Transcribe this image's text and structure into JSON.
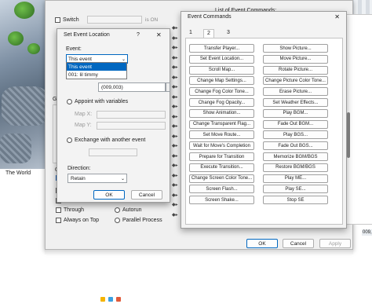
{
  "map": {
    "label": "The World"
  },
  "bottom_code": "009,",
  "editor": {
    "switch_label": "Switch",
    "switch_on": "is ON",
    "list_label": "List of Event Commands:",
    "options": [
      "Through",
      "Always on Top"
    ],
    "triggers": [
      "Autorun",
      "Parallel Process"
    ],
    "section_labels": {
      "graphic": "Grap",
      "options": "Op"
    },
    "buttons": {
      "ok": "OK",
      "cancel": "Cancel",
      "apply": "Apply"
    }
  },
  "location_dialog": {
    "title": "Set Event Location",
    "help": "?",
    "close": "✕",
    "event_label": "Event:",
    "event_value": "This event",
    "dropdown_options": [
      "This event",
      "001: lil timmy"
    ],
    "coords": "(009,003)",
    "radio_appoint": "Appoint with variables",
    "map_x": "Map X:",
    "map_y": "Map Y:",
    "radio_exchange": "Exchange with another event",
    "direction_label": "Direction:",
    "direction_value": "Retain",
    "ok": "OK",
    "cancel": "Cancel"
  },
  "commands_dialog": {
    "title": "Event Commands",
    "close": "✕",
    "tabs": [
      "1",
      "2",
      "3"
    ],
    "active_tab": "2",
    "left_commands": [
      "Transfer Player...",
      "Set Event Location...",
      "Scroll Map...",
      "Change Map Settings...",
      "Change Fog Color Tone...",
      "Change Fog Opacity...",
      "Show Animation...",
      "Change Transparent Flag...",
      "Set Move Route...",
      "Wait for Move's Completion",
      "Prepare for Transition",
      "Execute Transition...",
      "Change Screen Color Tone...",
      "Screen Flash...",
      "Screen Shake..."
    ],
    "right_commands": [
      "Show Picture...",
      "Move Picture...",
      "Rotate Picture...",
      "Change Picture Color Tone...",
      "Erase Picture...",
      "Set Weather Effects...",
      "Play BGM...",
      "Fade Out BGM...",
      "Play BGS...",
      "Fade Out BGS...",
      "Memorize BGM/BGS",
      "Restore BGM/BGS",
      "Play ME...",
      "Play SE...",
      "Stop SE"
    ]
  }
}
